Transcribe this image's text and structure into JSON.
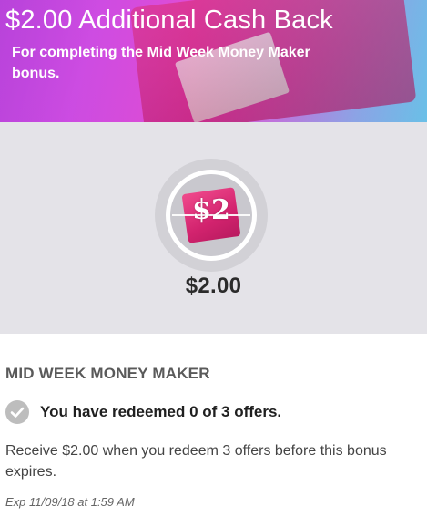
{
  "banner": {
    "title": "$2.00 Additional Cash Back",
    "subtitle": "For completing the Mid Week Money Maker bonus."
  },
  "badge": {
    "text": "$2"
  },
  "hero": {
    "amount": "$2.00"
  },
  "offer": {
    "title": "MID WEEK MONEY MAKER",
    "redeem_status": "You have redeemed 0 of 3 offers.",
    "description": "Receive $2.00 when you redeem 3 offers before this bonus expires.",
    "expiration": "Exp 11/09/18 at 1:59 AM"
  },
  "icons": {
    "check": "check-circle-icon"
  },
  "colors": {
    "hero_bg": "#e4e3e8",
    "check_gray": "#bdbdbd",
    "wallet_pink": "#d2236e"
  }
}
